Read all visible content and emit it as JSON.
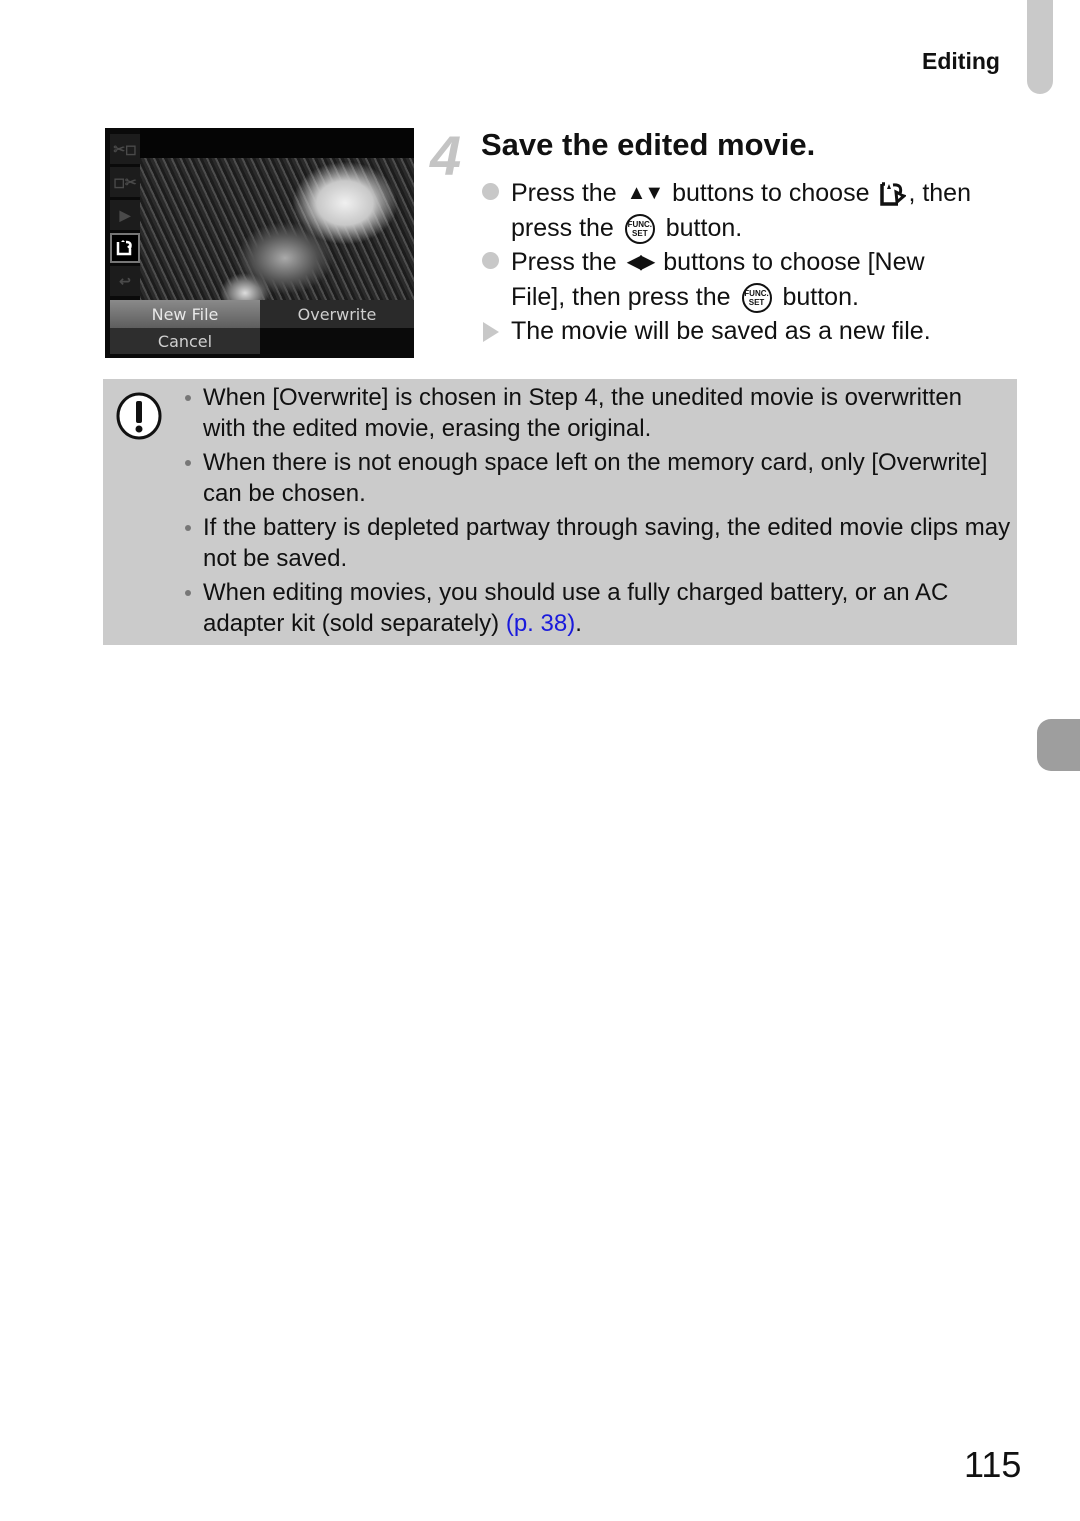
{
  "header": {
    "section_label": "Editing"
  },
  "camera_screen": {
    "menu_icons": [
      "cut-start-icon",
      "cut-end-icon",
      "play-icon",
      "save-icon",
      "return-icon"
    ],
    "selected_icon_index": 3,
    "buttons": {
      "new_file": "New File",
      "overwrite": "Overwrite",
      "cancel": "Cancel"
    }
  },
  "step": {
    "number": "4",
    "title": "Save the edited movie.",
    "items": [
      {
        "type": "action",
        "part1": "Press the",
        "keys": "▲▼",
        "part2": "buttons to choose",
        "part3": ", then",
        "part4": "press the",
        "part5": "button."
      },
      {
        "type": "action",
        "part1": "Press the",
        "keys": "◀▶",
        "part2": "buttons to choose [New",
        "part3": "File], then press the",
        "part4": "button."
      },
      {
        "type": "result",
        "text": "The movie will be saved as a new file."
      }
    ],
    "func_label_top": "FUNC.",
    "func_label_bottom": "SET"
  },
  "caution": {
    "icon": "caution-icon",
    "items": [
      "When [Overwrite] is chosen in Step 4, the unedited movie is overwritten with the edited movie, erasing the original.",
      "When there is not enough space left on the memory card, only [Overwrite] can be chosen.",
      "If the battery is depleted partway through saving, the edited movie clips may not be saved.",
      "When editing movies, you should use a fully charged battery, or an AC adapter kit (sold separately)"
    ],
    "link_text": "(p. 38)",
    "link_suffix": ".",
    "link_color": "#1a1adc"
  },
  "footer": {
    "page_number": "115"
  }
}
